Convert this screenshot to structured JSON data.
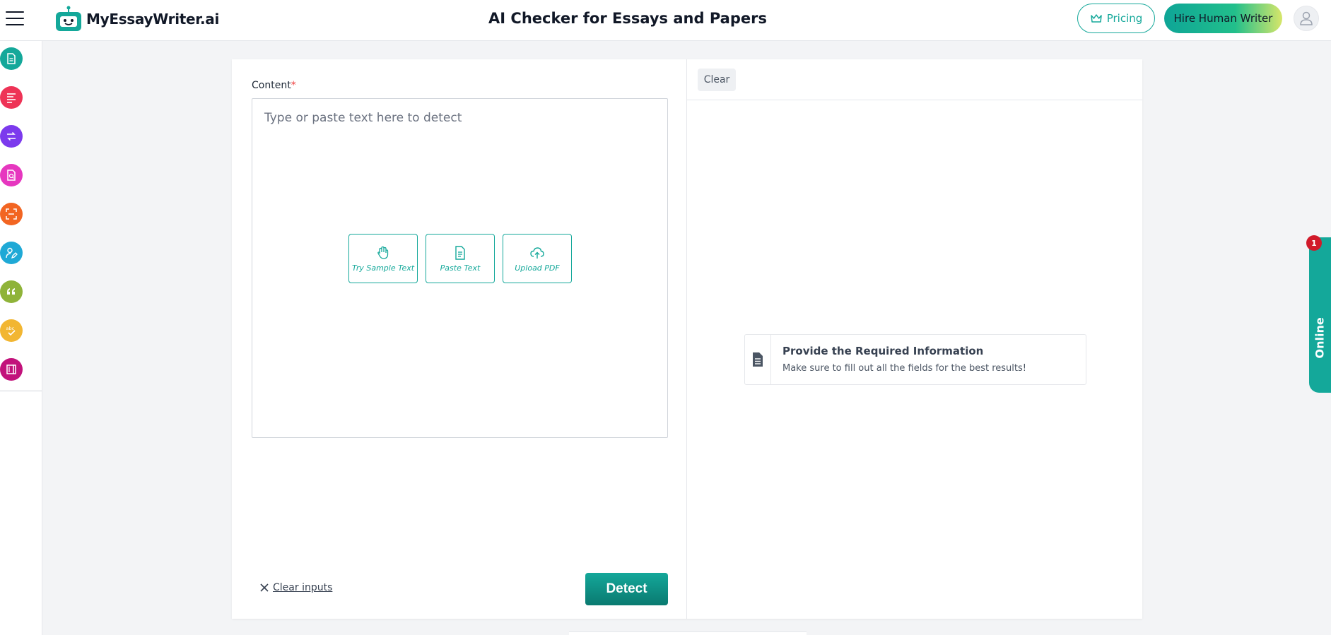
{
  "header": {
    "brand": "MyEssayWriter.ai",
    "title": "AI Checker for Essays and Papers",
    "pricing_label": "Pricing",
    "hire_label": "Hire Human Writer"
  },
  "sidebar": {
    "tools": [
      {
        "icon": "document-icon",
        "color": "#14a89a"
      },
      {
        "icon": "text-lines-icon",
        "color": "#ee3356"
      },
      {
        "icon": "paraphrase-icon",
        "color": "#7c3aed"
      },
      {
        "icon": "file-search-icon",
        "color": "#e637bf"
      },
      {
        "icon": "scan-text-icon",
        "color": "#f26522"
      },
      {
        "icon": "user-edit-icon",
        "color": "#1fa9d6"
      },
      {
        "icon": "quote-icon",
        "color": "#8fb339"
      },
      {
        "icon": "spell-check-icon",
        "color": "#f2b632"
      },
      {
        "icon": "book-icon",
        "color": "#c2127b"
      }
    ]
  },
  "editor": {
    "label": "Content",
    "required_mark": "*",
    "placeholder": "Type or paste text here to detect",
    "value": "",
    "actions": [
      {
        "label": "Try Sample Text",
        "icon": "hand-icon"
      },
      {
        "label": "Paste Text",
        "icon": "paste-document-icon"
      },
      {
        "label": "Upload PDF",
        "icon": "cloud-upload-icon"
      }
    ],
    "clear_inputs_label": "Clear inputs",
    "detect_label": "Detect"
  },
  "results": {
    "clear_label": "Clear",
    "info_title": "Provide the Required Information",
    "info_subtitle": "Make sure to fill out all the fields for the best results!"
  },
  "chat_widget": {
    "label": "Online",
    "badge_count": "1"
  },
  "colors": {
    "accent": "#14a89a",
    "required": "#ef4444",
    "badge": "#d11a2a"
  }
}
